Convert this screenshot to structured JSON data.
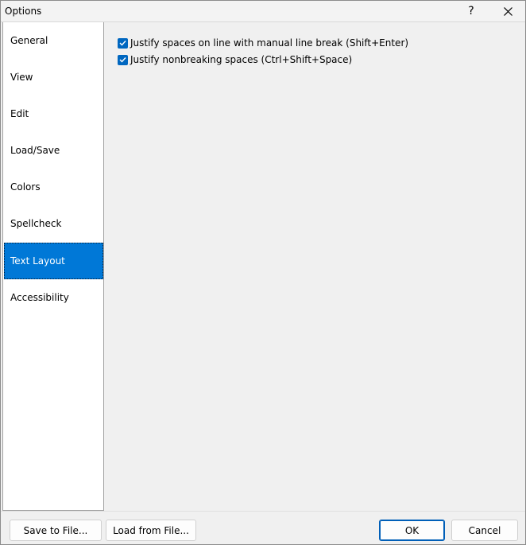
{
  "window": {
    "title": "Options",
    "help_label": "?",
    "close_icon": "close-icon"
  },
  "sidebar": {
    "items": [
      {
        "label": "General",
        "selected": false
      },
      {
        "label": "View",
        "selected": false
      },
      {
        "label": "Edit",
        "selected": false
      },
      {
        "label": "Load/Save",
        "selected": false
      },
      {
        "label": "Colors",
        "selected": false
      },
      {
        "label": "Spellcheck",
        "selected": false
      },
      {
        "label": "Text Layout",
        "selected": true
      },
      {
        "label": "Accessibility",
        "selected": false
      }
    ]
  },
  "content": {
    "options": [
      {
        "label": "Justify spaces on line with manual line break (Shift+Enter)",
        "checked": true
      },
      {
        "label": "Justify nonbreaking spaces (Ctrl+Shift+Space)",
        "checked": true
      }
    ]
  },
  "footer": {
    "save_label": "Save to File...",
    "load_label": "Load from File...",
    "ok_label": "OK",
    "cancel_label": "Cancel"
  },
  "colors": {
    "accent": "#0078d7",
    "checkbox": "#0067c0"
  }
}
